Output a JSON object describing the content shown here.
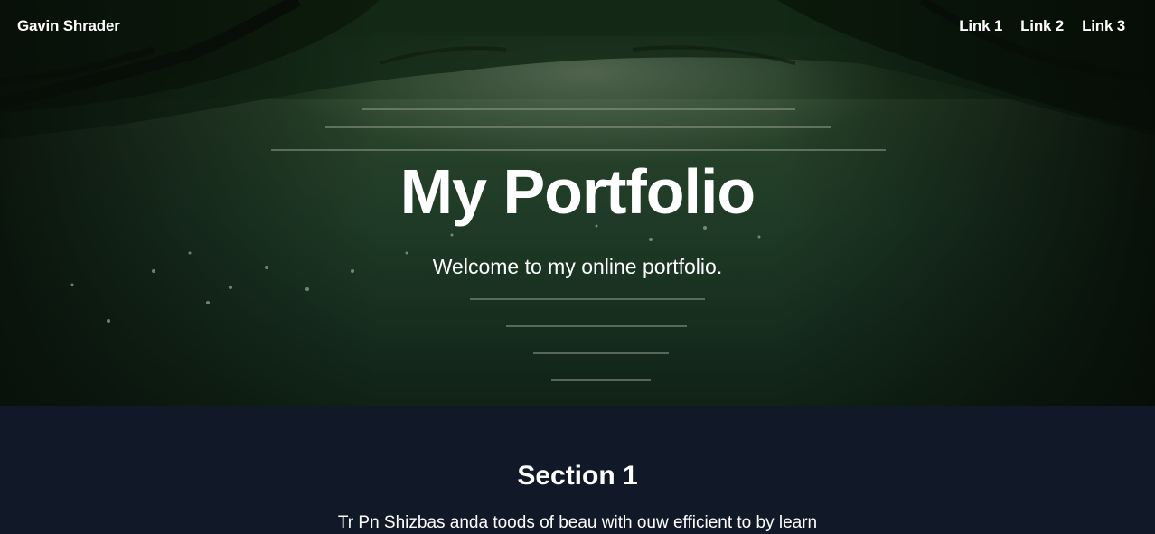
{
  "nav": {
    "brand": "Gavin Shrader",
    "links": [
      "Link 1",
      "Link 2",
      "Link 3"
    ]
  },
  "hero": {
    "title": "My Portfolio",
    "subtitle": "Welcome to my online portfolio.",
    "background_image": "river-through-forest-photo"
  },
  "section1": {
    "title": "Section 1",
    "body": "Tr Pn Shizbas anda toods of beau with ouw efficient to by learn"
  },
  "colors": {
    "section_background": "#111827",
    "text": "#ffffff"
  }
}
